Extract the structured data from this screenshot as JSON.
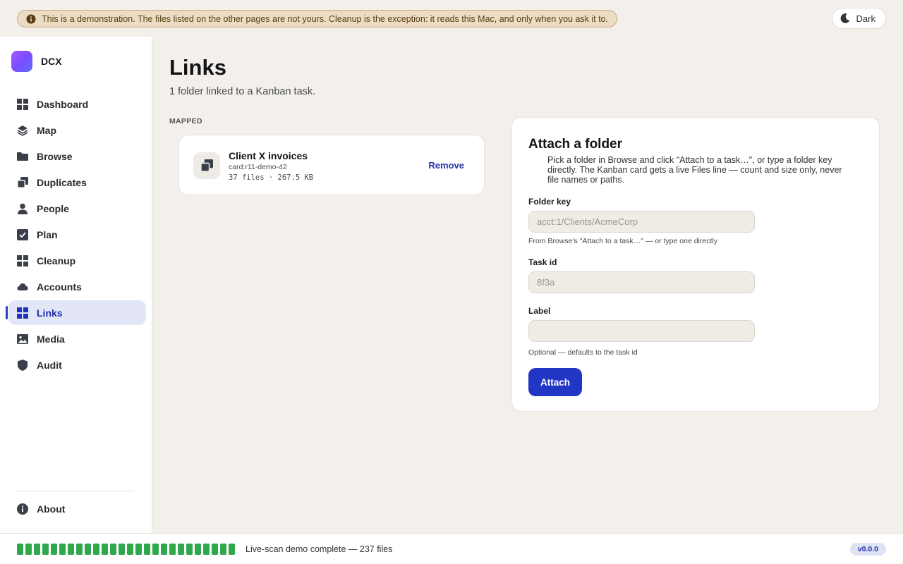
{
  "banner": {
    "text": "This is a demonstration. The files listed on the other pages are not yours. Cleanup is the exception: it reads this Mac, and only when you ask it to.",
    "icon": "info-icon"
  },
  "theme_toggle": {
    "label": "Dark",
    "icon": "moon-icon"
  },
  "app": {
    "name": "DCX"
  },
  "sidebar": {
    "items": [
      {
        "label": "Dashboard",
        "icon": "dashboard-icon"
      },
      {
        "label": "Map",
        "icon": "layers-icon"
      },
      {
        "label": "Browse",
        "icon": "folder-icon"
      },
      {
        "label": "Duplicates",
        "icon": "duplicates-icon"
      },
      {
        "label": "People",
        "icon": "person-icon"
      },
      {
        "label": "Plan",
        "icon": "checkbox-icon"
      },
      {
        "label": "Cleanup",
        "icon": "cleanup-icon"
      },
      {
        "label": "Accounts",
        "icon": "cloud-icon"
      },
      {
        "label": "Links",
        "icon": "links-icon",
        "active": true
      },
      {
        "label": "Media",
        "icon": "image-icon"
      },
      {
        "label": "Audit",
        "icon": "shield-icon"
      }
    ],
    "about": {
      "label": "About",
      "icon": "info-icon"
    }
  },
  "main": {
    "title": "Links",
    "subtitle": "1 folder linked to a Kanban task.",
    "section_label": "MAPPED",
    "links": [
      {
        "title": "Client X invoices",
        "card": "card:r11-demo-42",
        "stats": "37 files · 267.5 KB",
        "remove_label": "Remove"
      }
    ]
  },
  "attach": {
    "title": "Attach a folder",
    "description": "Pick a folder in Browse and click \"Attach to a task…\", or type a folder key directly. The Kanban card gets a live Files line — count and size only, never file names or paths.",
    "folder_key": {
      "label": "Folder key",
      "placeholder": "acct:1/Clients/AcmeCorp",
      "value": "",
      "hint": "From Browse's \"Attach to a task…\" — or type one directly"
    },
    "task_id": {
      "label": "Task id",
      "placeholder": "8f3a",
      "value": ""
    },
    "label_field": {
      "label": "Label",
      "placeholder": "",
      "value": "",
      "hint": "Optional — defaults to the task id"
    },
    "button": "Attach"
  },
  "footer": {
    "status": "Live-scan demo complete — 237 files",
    "progress": 1.0,
    "version": "v0.0.0"
  },
  "colors": {
    "accent": "#2236c5",
    "active_nav_bg": "#e3e6f7",
    "progress": "#2ea84a",
    "banner_bg": "#ecdcc3"
  }
}
